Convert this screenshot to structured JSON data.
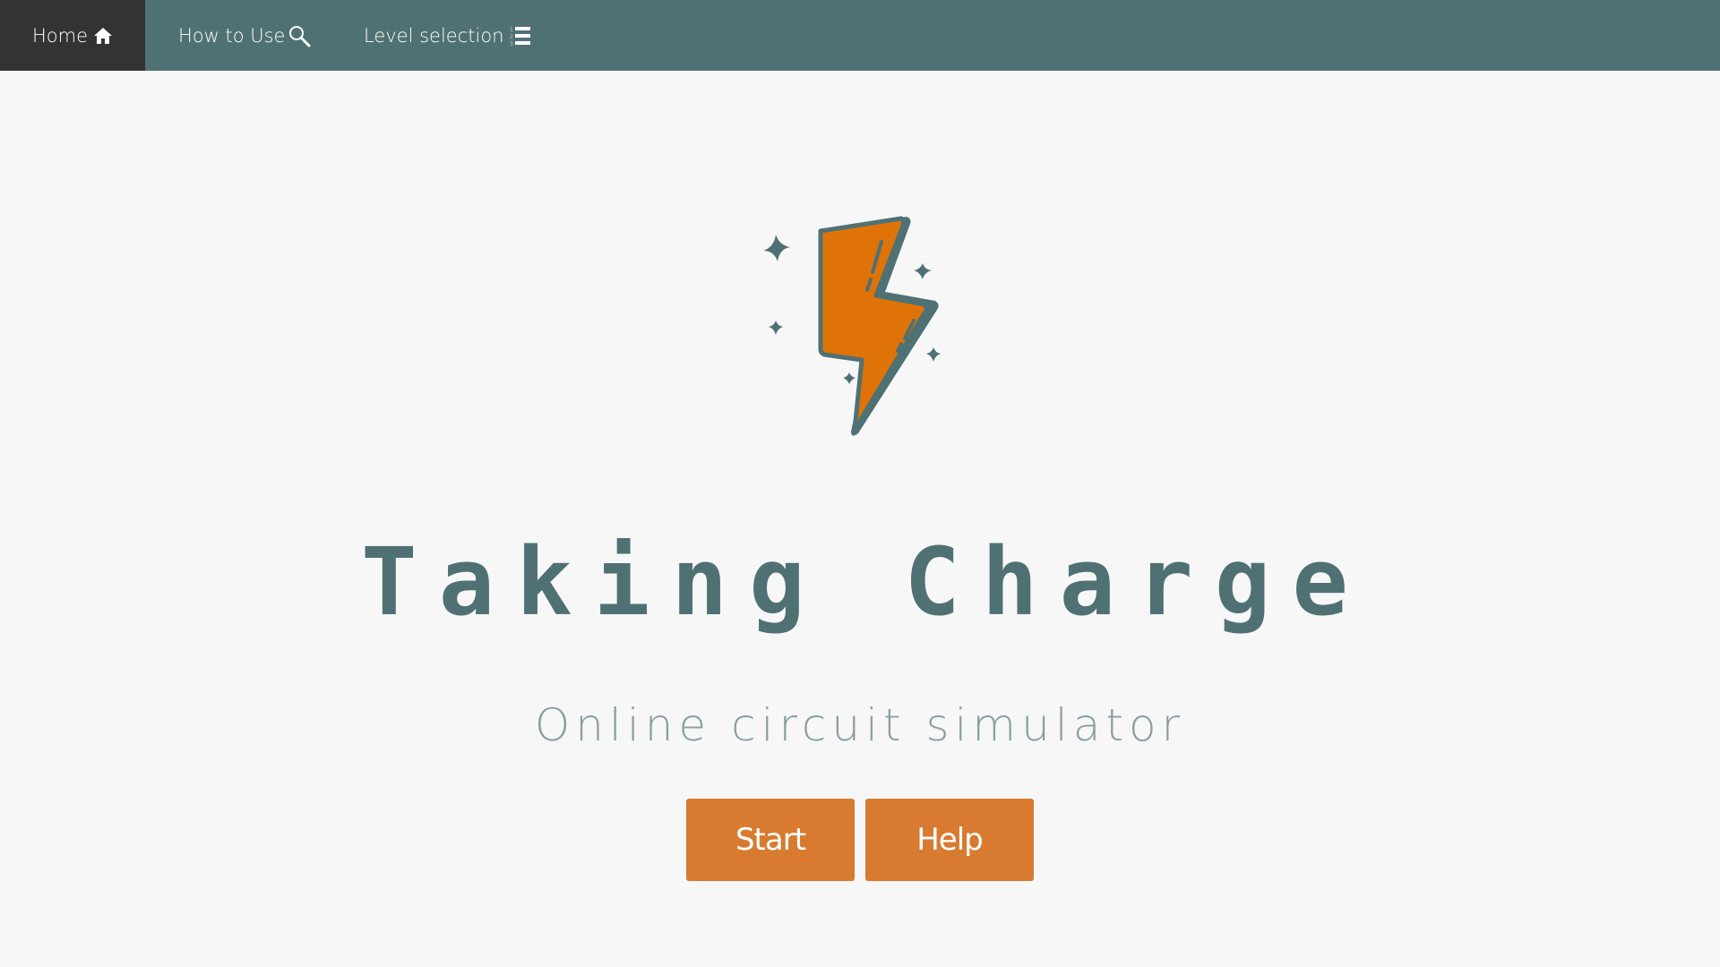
{
  "nav": {
    "home_label": "Home",
    "howto_label": "How to Use",
    "levels_label": "Level selection",
    "home_icon": "home-icon",
    "howto_icon": "search-icon",
    "levels_icon": "numbered-list-icon"
  },
  "hero": {
    "logo_icon": "lightning-bolt-icon",
    "title": "Taking Charge",
    "subtitle": "Online circuit simulator"
  },
  "actions": {
    "start_label": "Start",
    "help_label": "Help"
  },
  "colors": {
    "navbar": "#507173",
    "nav_active": "#333333",
    "accent": "#d87b30",
    "title": "#4f7174",
    "subtitle": "#8a9ea0",
    "background": "#f7f7f7"
  }
}
